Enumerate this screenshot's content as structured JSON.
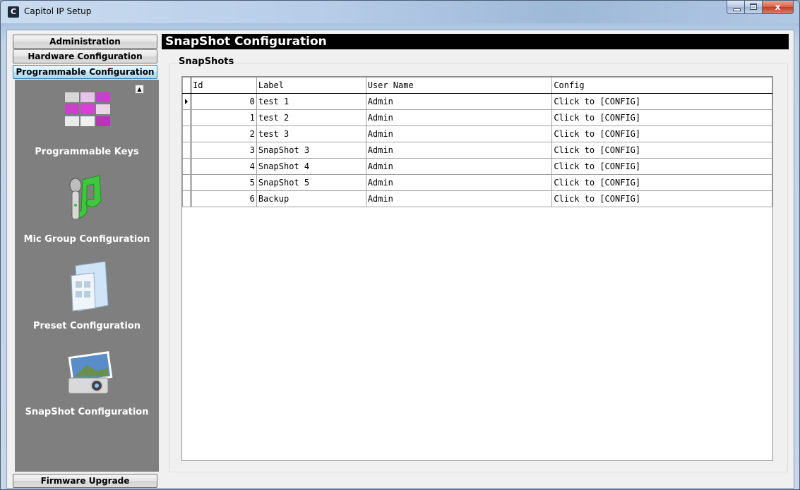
{
  "window": {
    "title": "Capitol IP Setup",
    "app_icon_letter": "C",
    "close_label": "x"
  },
  "nav": {
    "administration": "Administration",
    "hardware": "Hardware Configuration",
    "programmable": "Programmable Configuration",
    "firmware": "Firmware Upgrade"
  },
  "panel_items": [
    {
      "label": "Programmable Keys",
      "icon": "programmable-keys-icon"
    },
    {
      "label": "Mic Group Configuration",
      "icon": "mic-group-icon"
    },
    {
      "label": "Preset Configuration",
      "icon": "preset-folder-icon"
    },
    {
      "label": "SnapShot Configuration",
      "icon": "snapshot-camera-icon"
    }
  ],
  "main": {
    "title": "SnapShot Configuration",
    "group_label": "SnapShots",
    "columns": [
      "Id",
      "Label",
      "User Name",
      "Config"
    ],
    "rows": [
      {
        "id": "0",
        "label": "test 1",
        "user": "Admin",
        "config": "Click to [CONFIG]"
      },
      {
        "id": "1",
        "label": "test 2",
        "user": "Admin",
        "config": "Click to [CONFIG]"
      },
      {
        "id": "2",
        "label": "test 3",
        "user": "Admin",
        "config": "Click to [CONFIG]"
      },
      {
        "id": "3",
        "label": "SnapShot 3",
        "user": "Admin",
        "config": "Click to [CONFIG]"
      },
      {
        "id": "4",
        "label": "SnapShot 4",
        "user": "Admin",
        "config": "Click to [CONFIG]"
      },
      {
        "id": "5",
        "label": "SnapShot 5",
        "user": "Admin",
        "config": "Click to [CONFIG]"
      },
      {
        "id": "6",
        "label": "Backup",
        "user": "Admin",
        "config": "Click to [CONFIG]"
      }
    ]
  },
  "colors": {
    "panel_bg": "#7f7f7f",
    "title_bar_bg": "#000000",
    "active_nav_border": "#3c7fb1"
  }
}
